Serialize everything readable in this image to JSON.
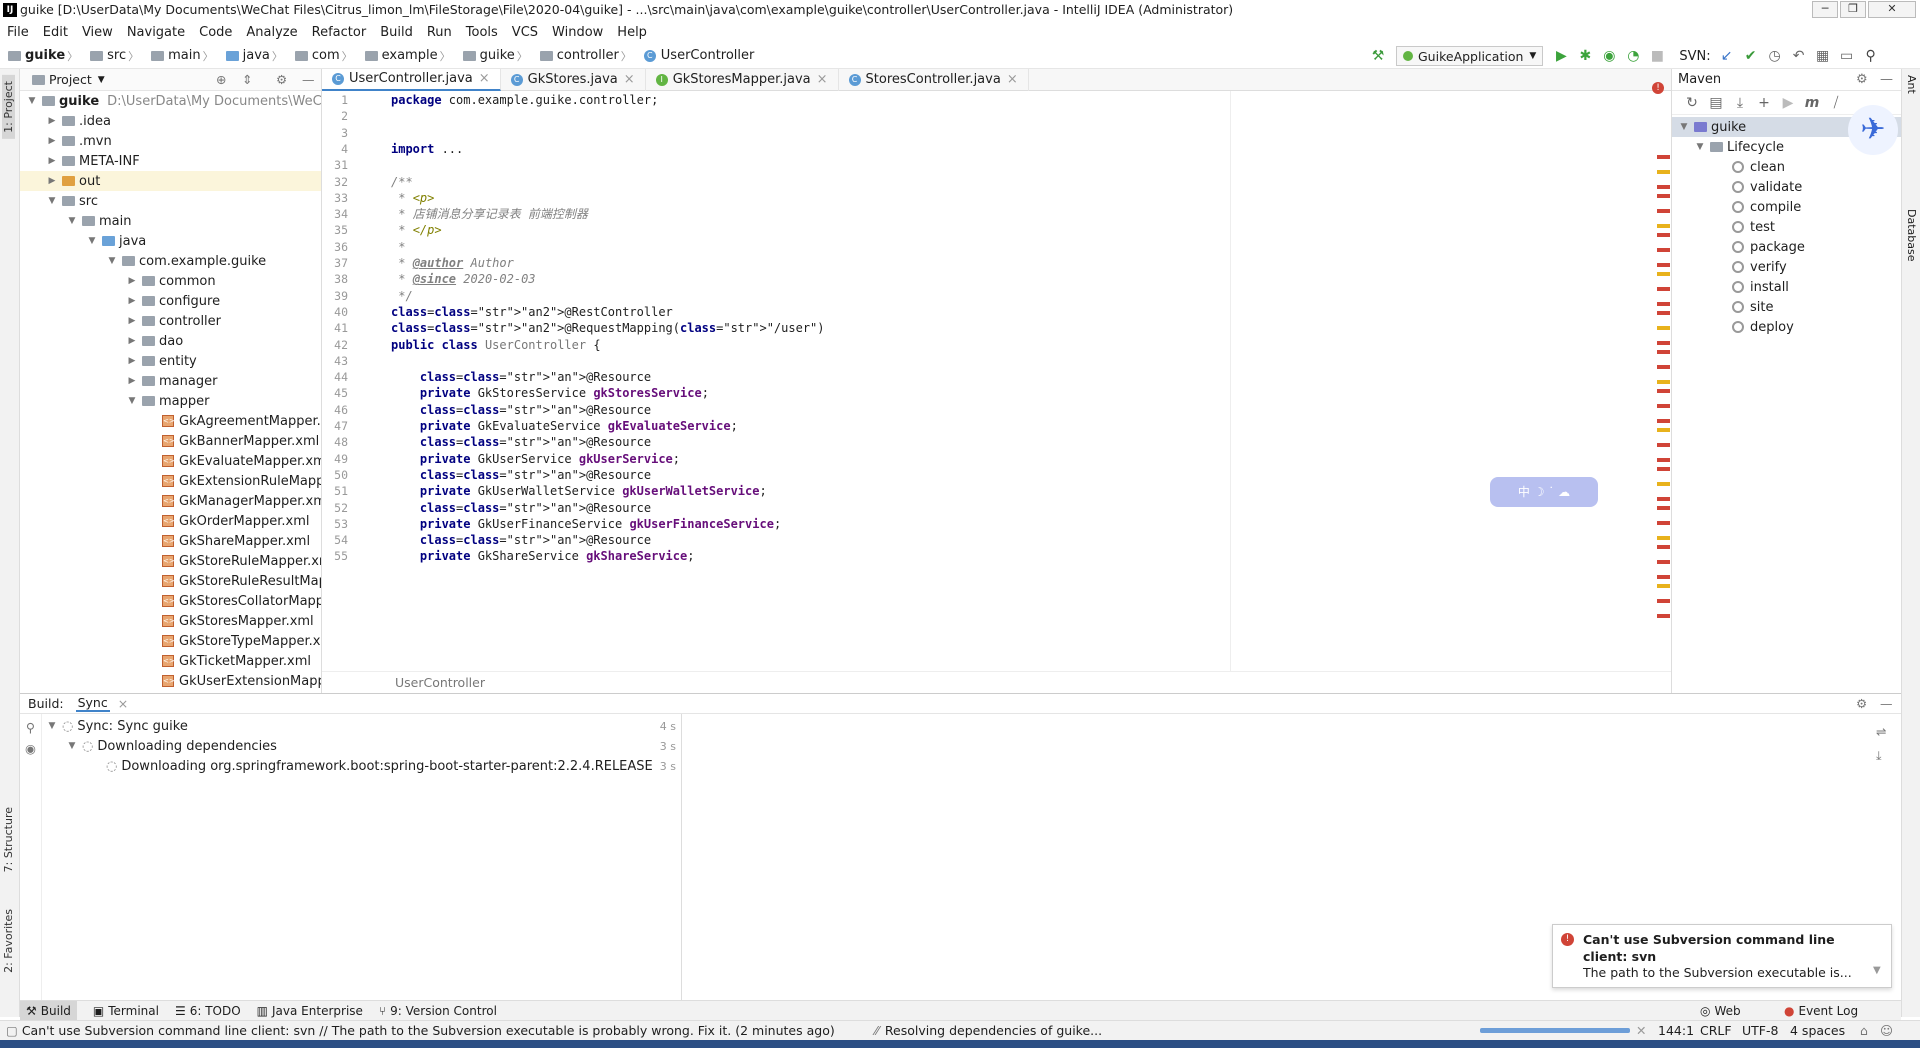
{
  "window": {
    "title": "guike [D:\\UserData\\My Documents\\WeChat Files\\Citrus_limon_lm\\FileStorage\\File\\2020-04\\guike] - ...\\src\\main\\java\\com\\example\\guike\\controller\\UserController.java - IntelliJ IDEA (Administrator)"
  },
  "menu": [
    "File",
    "Edit",
    "View",
    "Navigate",
    "Code",
    "Analyze",
    "Refactor",
    "Build",
    "Run",
    "Tools",
    "VCS",
    "Window",
    "Help"
  ],
  "breadcrumb": [
    "guike",
    "src",
    "main",
    "java",
    "com",
    "example",
    "guike",
    "controller",
    "UserController"
  ],
  "toolbar": {
    "run_config": "GuikeApplication",
    "svn_label": "SVN:"
  },
  "project": {
    "title": "Project",
    "root_name": "guike",
    "root_path": "D:\\UserData\\My Documents\\WeChat Files\\Citrus_limon_lm\\FileStorage\\File\\2020-04\\guike",
    "items": [
      {
        "label": "guike",
        "depth": 0,
        "arrow": "down",
        "type": "module"
      },
      {
        "label": ".idea",
        "depth": 1,
        "arrow": "right",
        "type": "folder"
      },
      {
        "label": ".mvn",
        "depth": 1,
        "arrow": "right",
        "type": "folder"
      },
      {
        "label": "META-INF",
        "depth": 1,
        "arrow": "right",
        "type": "folder"
      },
      {
        "label": "out",
        "depth": 1,
        "arrow": "right",
        "type": "folder-orange"
      },
      {
        "label": "src",
        "depth": 1,
        "arrow": "down",
        "type": "folder"
      },
      {
        "label": "main",
        "depth": 2,
        "arrow": "down",
        "type": "folder"
      },
      {
        "label": "java",
        "depth": 3,
        "arrow": "down",
        "type": "folder-blue"
      },
      {
        "label": "com.example.guike",
        "depth": 4,
        "arrow": "down",
        "type": "folder"
      },
      {
        "label": "common",
        "depth": 5,
        "arrow": "right",
        "type": "folder"
      },
      {
        "label": "configure",
        "depth": 5,
        "arrow": "right",
        "type": "folder"
      },
      {
        "label": "controller",
        "depth": 5,
        "arrow": "right",
        "type": "folder"
      },
      {
        "label": "dao",
        "depth": 5,
        "arrow": "right",
        "type": "folder"
      },
      {
        "label": "entity",
        "depth": 5,
        "arrow": "right",
        "type": "folder"
      },
      {
        "label": "manager",
        "depth": 5,
        "arrow": "right",
        "type": "folder"
      },
      {
        "label": "mapper",
        "depth": 5,
        "arrow": "down",
        "type": "folder"
      },
      {
        "label": "GkAgreementMapper.xml",
        "depth": 6,
        "arrow": "",
        "type": "xml"
      },
      {
        "label": "GkBannerMapper.xml",
        "depth": 6,
        "arrow": "",
        "type": "xml"
      },
      {
        "label": "GkEvaluateMapper.xml",
        "depth": 6,
        "arrow": "",
        "type": "xml"
      },
      {
        "label": "GkExtensionRuleMapper.xml",
        "depth": 6,
        "arrow": "",
        "type": "xml"
      },
      {
        "label": "GkManagerMapper.xml",
        "depth": 6,
        "arrow": "",
        "type": "xml"
      },
      {
        "label": "GkOrderMapper.xml",
        "depth": 6,
        "arrow": "",
        "type": "xml"
      },
      {
        "label": "GkShareMapper.xml",
        "depth": 6,
        "arrow": "",
        "type": "xml"
      },
      {
        "label": "GkStoreRuleMapper.xml",
        "depth": 6,
        "arrow": "",
        "type": "xml"
      },
      {
        "label": "GkStoreRuleResultMapper.xml",
        "depth": 6,
        "arrow": "",
        "type": "xml"
      },
      {
        "label": "GkStoresCollatorMapper.xml",
        "depth": 6,
        "arrow": "",
        "type": "xml"
      },
      {
        "label": "GkStoresMapper.xml",
        "depth": 6,
        "arrow": "",
        "type": "xml"
      },
      {
        "label": "GkStoreTypeMapper.xml",
        "depth": 6,
        "arrow": "",
        "type": "xml"
      },
      {
        "label": "GkTicketMapper.xml",
        "depth": 6,
        "arrow": "",
        "type": "xml"
      },
      {
        "label": "GkUserExtensionMapper.xml",
        "depth": 6,
        "arrow": "",
        "type": "xml"
      }
    ]
  },
  "editor": {
    "tabs": [
      {
        "label": "UserController.java",
        "active": true,
        "icon": "c"
      },
      {
        "label": "GkStores.java",
        "active": false,
        "icon": "c"
      },
      {
        "label": "GkStoresMapper.java",
        "active": false,
        "icon": "i"
      },
      {
        "label": "StoresController.java",
        "active": false,
        "icon": "c"
      }
    ],
    "lines": [
      {
        "n": "1",
        "t": "package com.example.guike.controller;"
      },
      {
        "n": "2",
        "t": ""
      },
      {
        "n": "3",
        "t": ""
      },
      {
        "n": "4",
        "t": "import ..."
      },
      {
        "n": "31",
        "t": ""
      },
      {
        "n": "32",
        "t": "/**"
      },
      {
        "n": "33",
        "t": " * <p>"
      },
      {
        "n": "34",
        "t": " * 店铺消息分享记录表 前端控制器"
      },
      {
        "n": "35",
        "t": " * </p>"
      },
      {
        "n": "36",
        "t": " *"
      },
      {
        "n": "37",
        "t": " * @author Author"
      },
      {
        "n": "38",
        "t": " * @since 2020-02-03"
      },
      {
        "n": "39",
        "t": " */"
      },
      {
        "n": "40",
        "t": "@RestController"
      },
      {
        "n": "41",
        "t": "@RequestMapping(\"/user\")"
      },
      {
        "n": "42",
        "t": "public class UserController {"
      },
      {
        "n": "43",
        "t": ""
      },
      {
        "n": "44",
        "t": "    @Resource"
      },
      {
        "n": "45",
        "t": "    private GkStoresService gkStoresService;"
      },
      {
        "n": "46",
        "t": "    @Resource"
      },
      {
        "n": "47",
        "t": "    private GkEvaluateService gkEvaluateService;"
      },
      {
        "n": "48",
        "t": "    @Resource"
      },
      {
        "n": "49",
        "t": "    private GkUserService gkUserService;"
      },
      {
        "n": "50",
        "t": "    @Resource"
      },
      {
        "n": "51",
        "t": "    private GkUserWalletService gkUserWalletService;"
      },
      {
        "n": "52",
        "t": "    @Resource"
      },
      {
        "n": "53",
        "t": "    private GkUserFinanceService gkUserFinanceService;"
      },
      {
        "n": "54",
        "t": "    @Resource"
      },
      {
        "n": "55",
        "t": "    private GkShareService gkShareService;"
      }
    ],
    "footer_crumb": "UserController"
  },
  "maven": {
    "title": "Maven",
    "project": "guike",
    "lifecycle": "Lifecycle",
    "goals": [
      "clean",
      "validate",
      "compile",
      "test",
      "package",
      "verify",
      "install",
      "site",
      "deploy"
    ]
  },
  "build": {
    "label": "Build:",
    "tab": "Sync",
    "rows": [
      {
        "text": "Sync: Sync guike",
        "bold_prefix": "Sync:",
        "time": "4 s"
      },
      {
        "text": "Downloading dependencies",
        "time": "3 s"
      },
      {
        "text": "Downloading org.springframework.boot:spring-boot-starter-parent:2.2.4.RELEASE",
        "time": "3 s"
      }
    ]
  },
  "bottom_tabs": [
    "Build",
    "Terminal",
    "6: TODO",
    "Java Enterprise",
    "9: Version Control"
  ],
  "bottom_right_tabs": [
    "Web",
    "Event Log"
  ],
  "left_stripe": [
    "1: Project",
    "7: Structure",
    "2: Favorites"
  ],
  "right_stripe": [
    "Ant",
    "Database"
  ],
  "notification": {
    "title": "Can't use Subversion command line client: svn",
    "body": "The path to the Subversion executable is..."
  },
  "status": {
    "message": "Can't use Subversion command line client: svn // The path to the Subversion executable is probably wrong. Fix it. (2 minutes ago)",
    "progress": "Resolving dependencies of guike...",
    "position": "144:1",
    "line_sep": "CRLF",
    "encoding": "UTF-8",
    "indent": "4 spaces"
  },
  "colors": {
    "accent": "#4083c9",
    "error": "#d04437",
    "warning": "#e8b21c"
  }
}
